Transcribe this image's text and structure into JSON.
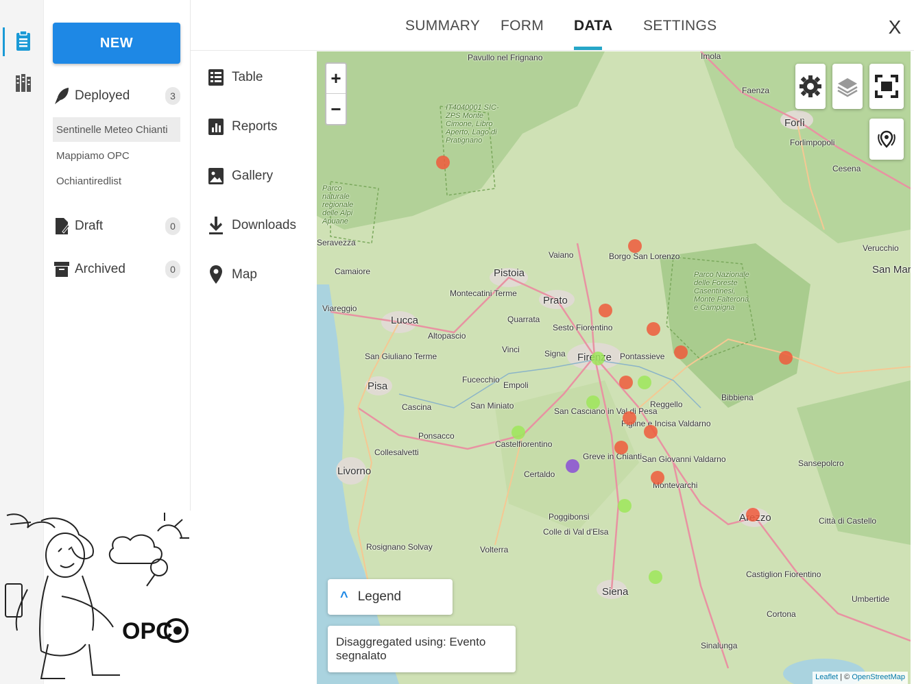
{
  "rail": {
    "items": [
      {
        "icon": "clipboard-icon",
        "active": true
      },
      {
        "icon": "library-icon",
        "active": false
      }
    ]
  },
  "left_panel": {
    "new_button": "NEW",
    "deployed": {
      "label": "Deployed",
      "count": "3"
    },
    "forms": [
      "Sentinelle Meteo Chianti",
      "Mappiamo OPC",
      "Ochiantiredlist"
    ],
    "draft": {
      "label": "Draft",
      "count": "0"
    },
    "archived": {
      "label": "Archived",
      "count": "0"
    }
  },
  "tabs": [
    {
      "label": "SUMMARY"
    },
    {
      "label": "FORM"
    },
    {
      "label": "DATA"
    },
    {
      "label": "SETTINGS"
    }
  ],
  "active_tab": "DATA",
  "close_label": "X",
  "subnav": [
    {
      "label": "Table",
      "icon": "table-icon"
    },
    {
      "label": "Reports",
      "icon": "reports-icon"
    },
    {
      "label": "Gallery",
      "icon": "gallery-icon"
    },
    {
      "label": "Downloads",
      "icon": "download-icon"
    },
    {
      "label": "Map",
      "icon": "map-pin-icon"
    }
  ],
  "map": {
    "zoom_in": "+",
    "zoom_out": "−",
    "legend_label": "Legend",
    "disaggregated_text": "Disaggregated using: Evento segnalato",
    "attribution_leaflet": "Leaflet",
    "attribution_sep": " | © ",
    "attribution_osm": "OpenStreetMap",
    "place_labels": [
      "Pavullo nel Frignano",
      "Imola",
      "Faenza",
      "Forlì",
      "Forlimpopoli",
      "Cesena",
      "Pistoia",
      "Prato",
      "Lucca",
      "Viareggio",
      "Camaiore",
      "Pisa",
      "Cascina",
      "Livorno",
      "Firenze",
      "Sesto Fiorentino",
      "Pontassieve",
      "Empoli",
      "Vinci",
      "Signa",
      "Quarrata",
      "Montecatini Terme",
      "Altopascio",
      "San Giuliano Terme",
      "Fucecchio",
      "San Miniato",
      "Ponsacco",
      "Collesalvetti",
      "Castelfiorentino",
      "Certaldo",
      "San Casciano in Val di Pesa",
      "Greve in Chianti",
      "Figline e Incisa Valdarno",
      "Reggello",
      "San Giovanni Valdarno",
      "Montevarchi",
      "Arezzo",
      "Poggibonsi",
      "Colle di Val d'Elsa",
      "Volterra",
      "Rosignano Solvay",
      "Siena",
      "Castiglion Fiorentino",
      "Cortona",
      "Sinalunga",
      "Umbertide",
      "Città di Castello",
      "Sansepolcro",
      "Bibbiena",
      "Borgo San Lorenzo",
      "Vaiano",
      "Verucchio",
      "San Marino",
      "Seravezza"
    ],
    "park_labels": [
      "IT4040001 SIC-ZPS Monte Cimone, Libro Aperto, Lago di Pratignano",
      "Parco naturale regionale delle Alpi Apuane",
      "Parco Nazionale delle Foreste Casentinesi, Monte Falterona e Campigna"
    ],
    "marker_colors": {
      "red": "#ef5a3c",
      "green": "#9ee65a",
      "purple": "#8a4fd6"
    }
  }
}
